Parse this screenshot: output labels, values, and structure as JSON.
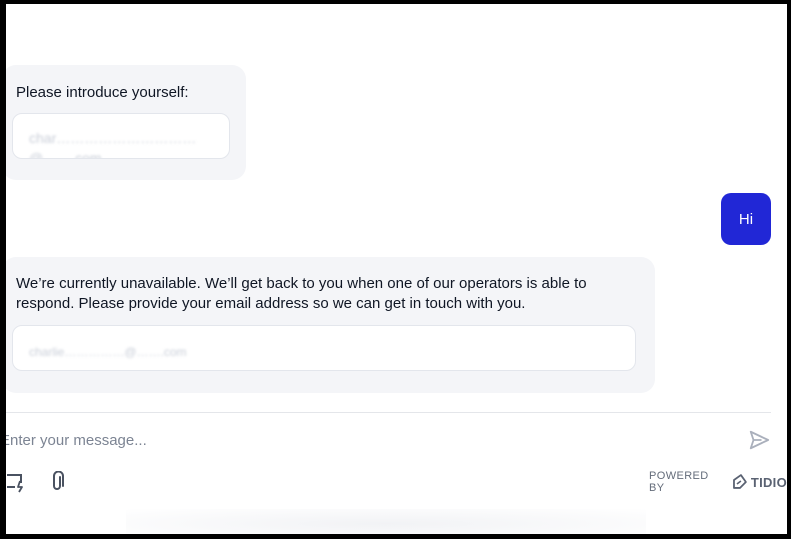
{
  "messages": [
    {
      "from": "bot",
      "text": "Please introduce yourself:",
      "field_value": "char…………………………@…….com"
    },
    {
      "from": "user",
      "text": "Hi"
    },
    {
      "from": "bot",
      "text": "We’re currently unavailable. We’ll get back to you when one of our operators is able to respond. Please provide your email address so we can get in touch with you.",
      "field_value": "charlie……………@…….com"
    }
  ],
  "composer": {
    "placeholder": "Enter your message..."
  },
  "footer": {
    "powered_by": "POWERED BY",
    "brand": "TIDIO"
  },
  "icons": {
    "send": "send-icon",
    "quick_actions": "quick-actions-icon",
    "attach": "paperclip-icon",
    "brand_logo": "tidio-logo-icon"
  },
  "colors": {
    "user_bubble": "#2127d6",
    "bot_bubble": "#f4f5f8",
    "text": "#0f1624",
    "muted": "#7c8493"
  }
}
